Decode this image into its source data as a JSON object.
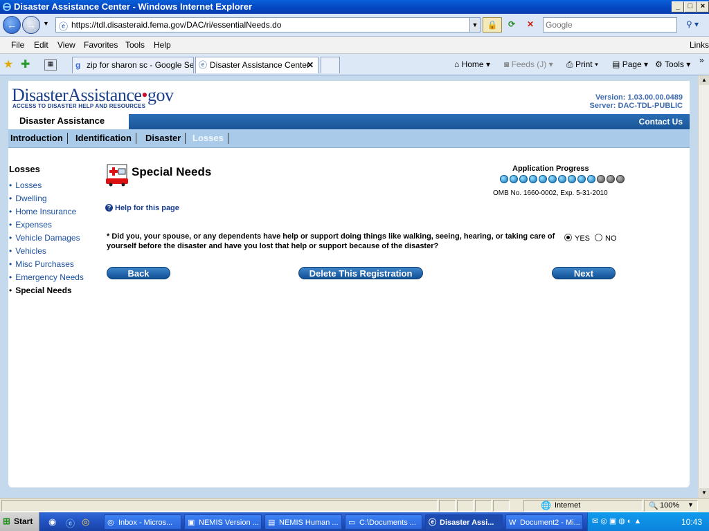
{
  "window": {
    "title": "Disaster Assistance Center - Windows Internet Explorer"
  },
  "browser": {
    "url": "https://tdl.disasteraid.fema.gov/DAC/ri/essentialNeeds.do",
    "search_placeholder": "Google",
    "menu": [
      "File",
      "Edit",
      "View",
      "Favorites",
      "Tools",
      "Help"
    ],
    "links_label": "Links",
    "tabs": [
      {
        "label": "zip for sharon sc - Google Se..."
      },
      {
        "label": "Disaster Assistance Center"
      }
    ],
    "toolbar": {
      "home": "Home",
      "feeds": "Feeds (J)",
      "print": "Print",
      "page": "Page",
      "tools": "Tools"
    },
    "status": {
      "zone": "Internet",
      "zoom": "100%"
    }
  },
  "site": {
    "logo_main": "DisasterAssistance",
    "logo_dot": "•",
    "logo_gov": "gov",
    "logo_tagline": "ACCESS TO DISASTER HELP AND RESOURCES",
    "version": "Version: 1.03.00.00.0489",
    "server": "Server: DAC-TDL-PUBLIC",
    "section_label": "Disaster Assistance",
    "contact_us": "Contact Us",
    "nav": [
      "Introduction",
      "Identification",
      "Disaster",
      "Losses"
    ]
  },
  "leftnav": {
    "heading": "Losses",
    "items": [
      "Losses",
      "Dwelling",
      "Home Insurance",
      "Expenses",
      "Vehicle Damages",
      "Vehicles",
      "Misc Purchases",
      "Emergency Needs",
      "Special Needs"
    ]
  },
  "main": {
    "title": "Special Needs",
    "progress_title": "Application Progress",
    "progress": {
      "completed": 10,
      "total": 13
    },
    "omb": "OMB No. 1660-0002, Exp. 5-31-2010",
    "help_link": "Help for this page",
    "question": "* Did you, your spouse, or any dependents have help or support doing things like walking, seeing, hearing, or taking care of yourself before the disaster and have you lost that help or support because of the disaster?",
    "yes_label": "YES",
    "no_label": "NO",
    "selected": "YES",
    "back": "Back",
    "delete": "Delete This Registration",
    "next": "Next"
  },
  "taskbar": {
    "start": "Start",
    "tasks": [
      "Inbox - Micros...",
      "NEMIS Version ...",
      "NEMIS Human ...",
      "C:\\Documents ...",
      "Disaster Assi...",
      "Document2 - Mi..."
    ],
    "clock": "10:43"
  }
}
